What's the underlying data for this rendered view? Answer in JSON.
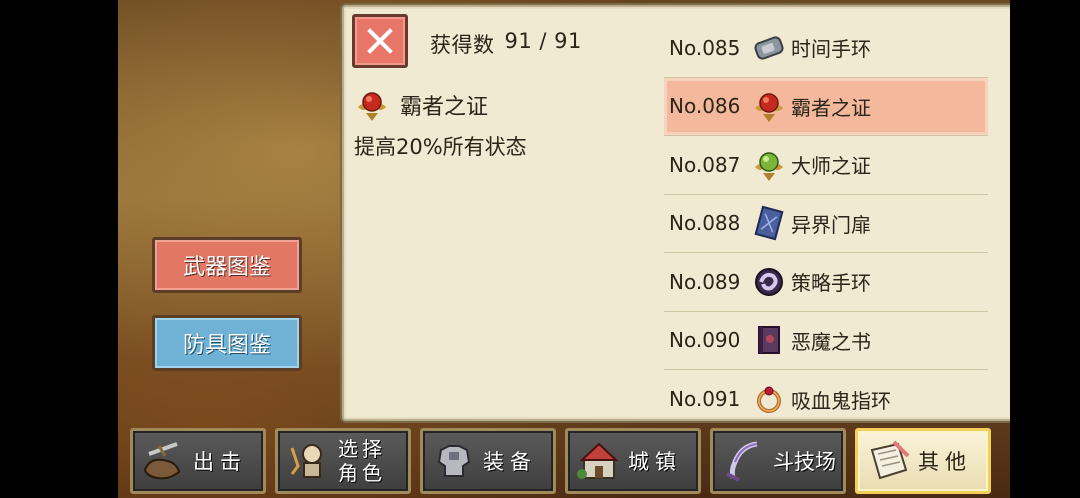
{
  "header": {
    "count_label": "获得数",
    "count_value": "91 / 91"
  },
  "detail": {
    "name": "霸者之证",
    "description": "提高20%所有状态"
  },
  "items": [
    {
      "no": "No.085",
      "name": "时间手环",
      "icon": "bracelet-icon"
    },
    {
      "no": "No.086",
      "name": "霸者之证",
      "icon": "red-medal-icon",
      "selected": true
    },
    {
      "no": "No.087",
      "name": "大师之证",
      "icon": "green-medal-icon"
    },
    {
      "no": "No.088",
      "name": "异界门扉",
      "icon": "blue-card-icon"
    },
    {
      "no": "No.089",
      "name": "策略手环",
      "icon": "swirl-bracelet-icon"
    },
    {
      "no": "No.090",
      "name": "恶魔之书",
      "icon": "demon-book-icon"
    },
    {
      "no": "No.091",
      "name": "吸血鬼指环",
      "icon": "vampire-ring-icon"
    }
  ],
  "side_buttons": {
    "weapon": "武器图鉴",
    "armor": "防具图鉴"
  },
  "nav": {
    "attack": "出击",
    "select_line1": "选择",
    "select_line2": "角色",
    "equip": "装备",
    "town": "城镇",
    "arena": "斗技场",
    "other": "其他"
  },
  "colors": {
    "panel_bg": "#f1ead3",
    "selected_row": "#f4b99c",
    "weapon_button": "#e37766",
    "armor_button": "#6fb2d6",
    "close_button": "#e8776a"
  }
}
